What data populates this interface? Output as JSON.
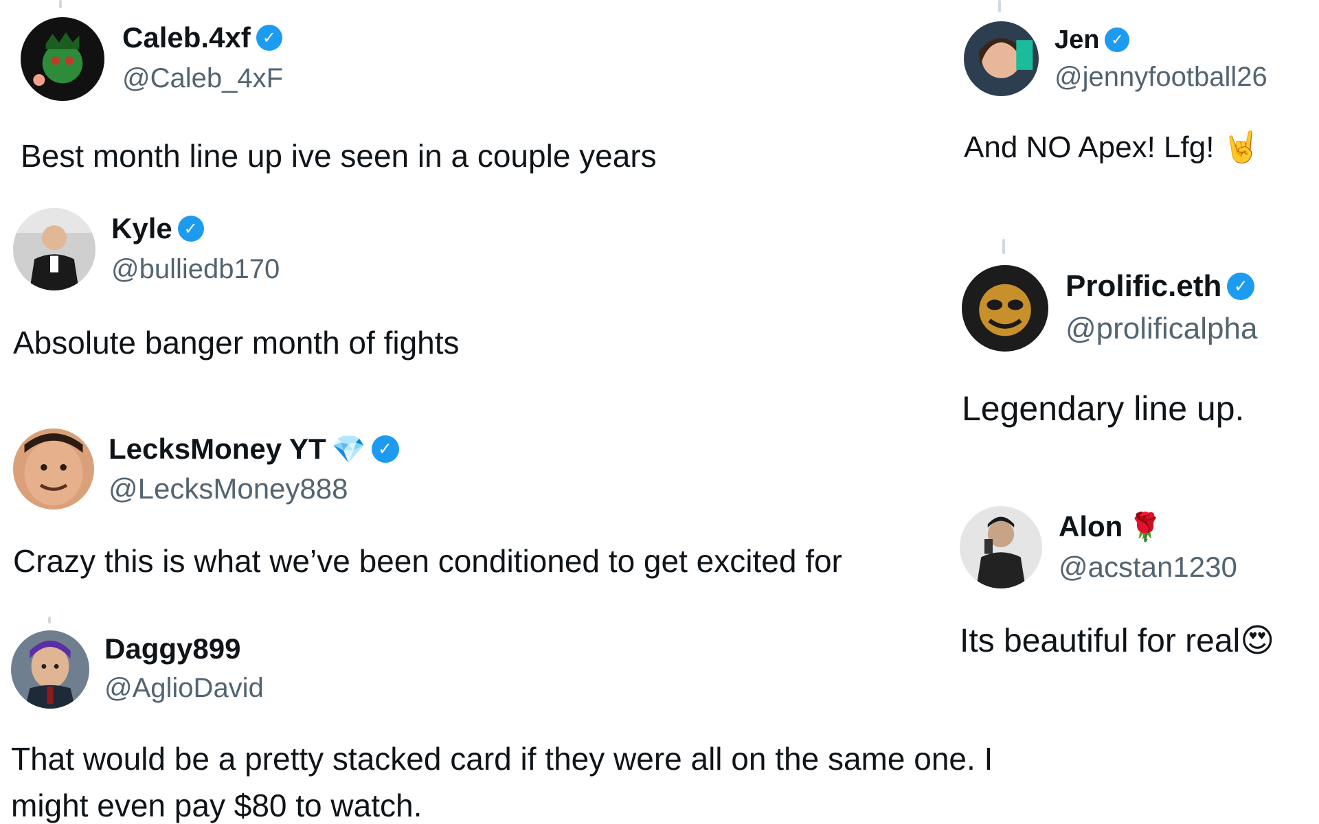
{
  "replies": [
    {
      "name": "Caleb.4xf",
      "handle": "@Caleb_4xF",
      "text": "Best month line up ive seen in a couple years",
      "verified": true
    },
    {
      "name": "Jen",
      "handle": "@jennyfootball26",
      "text": "And NO Apex! Lfg! 🤘",
      "verified": true
    },
    {
      "name": "Kyle",
      "handle": "@bulliedb170",
      "text": "Absolute banger month of fights",
      "verified": true
    },
    {
      "name": "Prolific.eth",
      "handle": "@prolificalpha",
      "text": "Legendary line up.",
      "verified": true
    },
    {
      "name": "LecksMoney YT",
      "handle": "@LecksMoney888",
      "text": "Crazy this is what we’ve been conditioned to get excited for",
      "verified": true,
      "badge": "💎"
    },
    {
      "name": "Alon",
      "handle": "@acstan1230",
      "text": "Its beautiful for real😍",
      "verified": false,
      "badge": "🌹"
    },
    {
      "name": "Daggy899",
      "handle": "@AglioDavid",
      "text_line1": "That would be a pretty stacked card if they were all on the same one. I",
      "text_line2": "might even pay $80 to watch.",
      "verified": false
    }
  ],
  "icons": {
    "verified": "verified-check-icon",
    "accent": "#1d9bf0",
    "handle_color": "#536471"
  }
}
